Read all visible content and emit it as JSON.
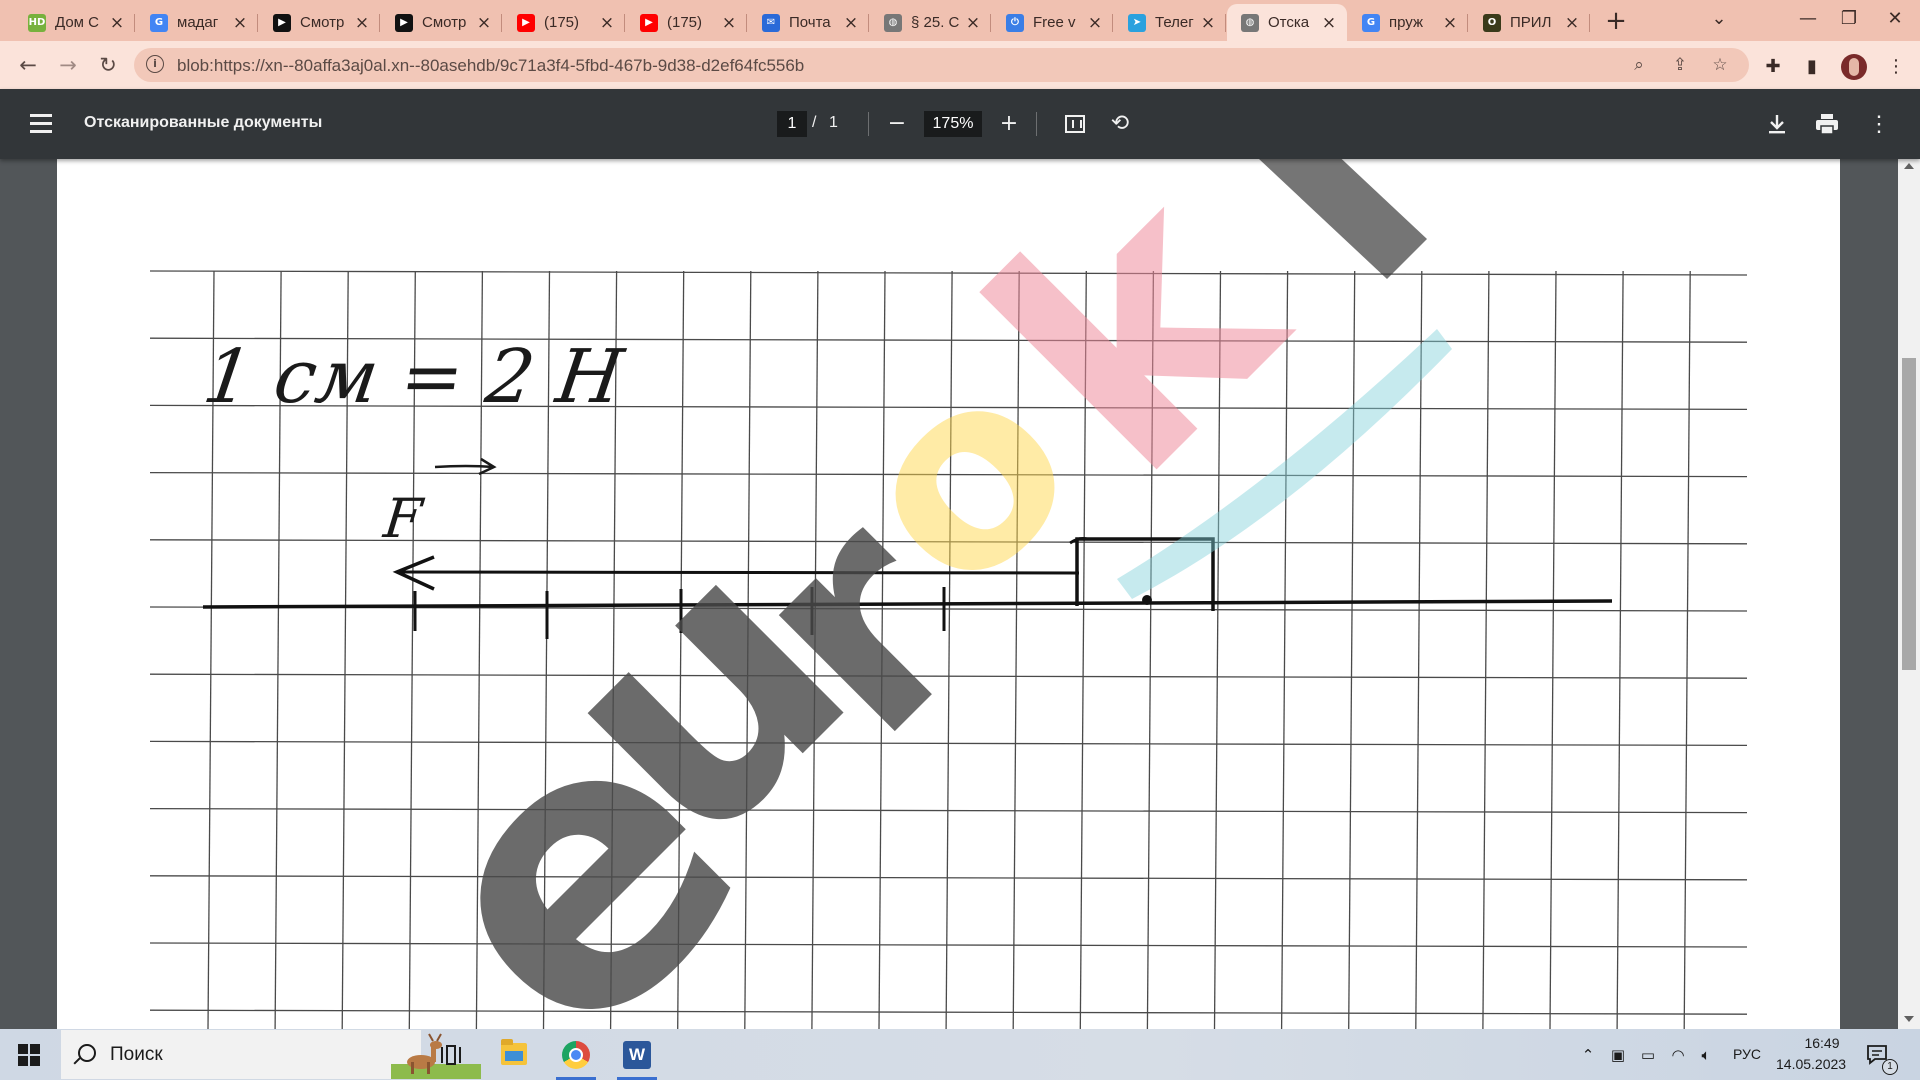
{
  "browser": {
    "tabs": [
      {
        "title": "Дом С",
        "favicon_text": "HD",
        "favicon_color": "#77b13d",
        "active": false
      },
      {
        "title": "мадаг",
        "favicon_text": "G",
        "favicon_color": "#4285f4",
        "active": false
      },
      {
        "title": "Смотр",
        "favicon_text": "▶",
        "favicon_color": "#111111",
        "active": false
      },
      {
        "title": "Смотр",
        "favicon_text": "▶",
        "favicon_color": "#111111",
        "active": false
      },
      {
        "title": "(175)",
        "favicon_text": "▶",
        "favicon_color": "#ff0000",
        "active": false
      },
      {
        "title": "(175)",
        "favicon_text": "▶",
        "favicon_color": "#ff0000",
        "active": false
      },
      {
        "title": "Почта",
        "favicon_text": "✉",
        "favicon_color": "#2a6ad8",
        "active": false
      },
      {
        "title": "§ 25. С",
        "favicon_text": "◍",
        "favicon_color": "#777777",
        "active": false
      },
      {
        "title": "Free v",
        "favicon_text": "⏻",
        "favicon_color": "#3a7ee6",
        "active": false
      },
      {
        "title": "Телег",
        "favicon_text": "➤",
        "favicon_color": "#2aa1de",
        "active": false
      },
      {
        "title": "Отска",
        "favicon_text": "◍",
        "favicon_color": "#777777",
        "active": true
      },
      {
        "title": "пруж",
        "favicon_text": "G",
        "favicon_color": "#4285f4",
        "active": false
      },
      {
        "title": "ПРИЛ",
        "favicon_text": "O",
        "favicon_color": "#3a3a1a",
        "active": false
      }
    ],
    "tab_close_glyph": "×",
    "new_tab_glyph": "+",
    "url": "blob:https://xn--80affa3aj0al.xn--80asehdb/9c71a3f4-5fbd-467b-9d38-d2ef64fc556b"
  },
  "pdf": {
    "title": "Отсканированные документы",
    "page_current": "1",
    "page_separator": "/",
    "page_total": "1",
    "zoom": "175%"
  },
  "document": {
    "scale_note": "1 см = 2 Н",
    "vector_label": "F"
  },
  "watermark": {
    "letters": [
      "e",
      "u",
      "r",
      "o",
      "k",
      "i"
    ]
  },
  "taskbar": {
    "search_placeholder": "Поиск",
    "language": "РУС",
    "time": "16:49",
    "date": "14.05.2023",
    "notification_count": "1"
  },
  "colors": {
    "tabstrip": "#f0c1b1",
    "toolbar": "#fbe3da",
    "pdf_toolbar": "#323639",
    "viewer_bg": "#525659",
    "watermark_grey": "#4b4b4b",
    "watermark_pink": "#ef8a9a",
    "watermark_yellow": "#ffd54a",
    "watermark_cyan": "#7fd0d8"
  }
}
